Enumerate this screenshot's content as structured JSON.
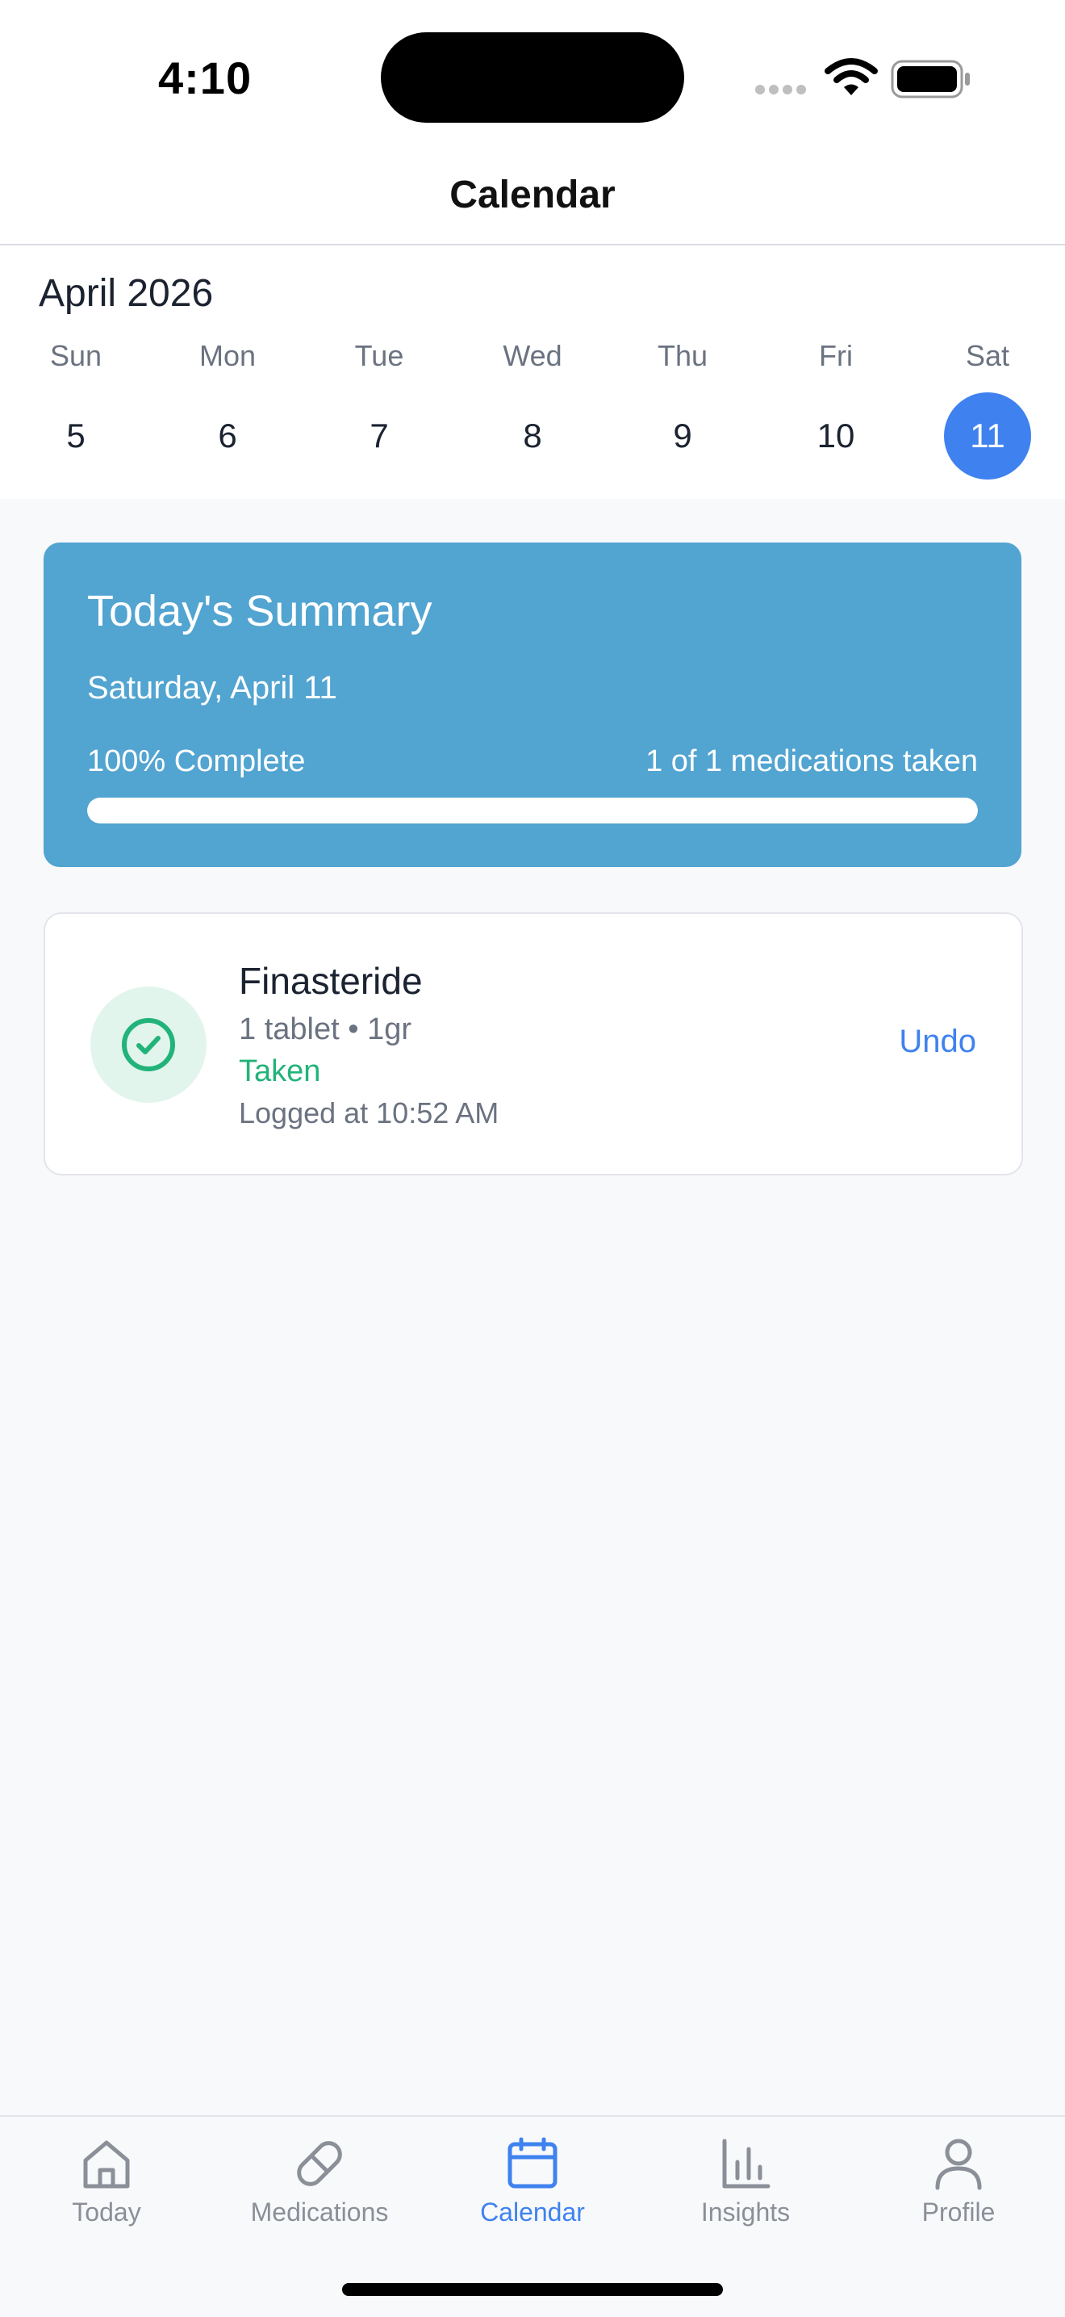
{
  "status_bar": {
    "time": "4:10"
  },
  "nav": {
    "title": "Calendar"
  },
  "calendar": {
    "month_label": "April 2026",
    "weekdays": [
      "Sun",
      "Mon",
      "Tue",
      "Wed",
      "Thu",
      "Fri",
      "Sat"
    ],
    "days": [
      "5",
      "6",
      "7",
      "8",
      "9",
      "10",
      "11"
    ],
    "selected_day": "11"
  },
  "summary": {
    "title": "Today's Summary",
    "date": "Saturday, April 11",
    "percent_label": "100% Complete",
    "count_label": "1 of 1 medications taken",
    "progress_fraction": 1.0
  },
  "medications": [
    {
      "name": "Finasteride",
      "dose": "1 tablet • 1gr",
      "status": "Taken",
      "logged": "Logged at 10:52 AM",
      "action_label": "Undo",
      "icon": "check-circle-icon"
    }
  ],
  "tabs": [
    {
      "label": "Today",
      "icon": "home-icon",
      "active": false
    },
    {
      "label": "Medications",
      "icon": "pill-icon",
      "active": false
    },
    {
      "label": "Calendar",
      "icon": "calendar-icon",
      "active": true
    },
    {
      "label": "Insights",
      "icon": "bar-chart-icon",
      "active": false
    },
    {
      "label": "Profile",
      "icon": "person-icon",
      "active": false
    }
  ],
  "colors": {
    "accent": "#3f82ef",
    "summary_bg": "#52a4d1",
    "success": "#22b37a",
    "inactive": "#8a8f98"
  }
}
